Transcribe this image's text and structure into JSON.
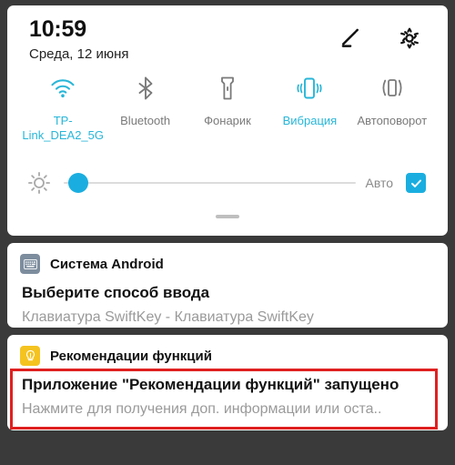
{
  "statusbar": {
    "time": "10:59",
    "date": "Среда, 12 июня",
    "edit_icon": "pencil-icon",
    "settings_icon": "gear-icon"
  },
  "quick_settings": {
    "tiles": [
      {
        "label": "TP-Link_DEA2_5G",
        "icon": "wifi-icon",
        "active": true
      },
      {
        "label": "Bluetooth",
        "icon": "bluetooth-icon",
        "active": false
      },
      {
        "label": "Фонарик",
        "icon": "flashlight-icon",
        "active": false
      },
      {
        "label": "Вибрация",
        "icon": "vibration-icon",
        "active": true
      },
      {
        "label": "Автоповорот",
        "icon": "auto-rotate-icon",
        "active": false
      }
    ],
    "brightness": {
      "icon": "brightness-sun-icon",
      "value_percent": 5,
      "auto_label": "Авто",
      "auto_checked": true
    },
    "drag_handle": "expand-handle"
  },
  "notifications": [
    {
      "app": "Система Android",
      "icon": "keyboard-icon",
      "title": "Выберите способ ввода",
      "body": "Клавиатура SwiftKey - Клавиатура SwiftKey",
      "highlighted": false
    },
    {
      "app": "Рекомендации функций",
      "icon": "lightbulb-icon",
      "title": "Приложение \"Рекомендации функций\" запущено",
      "body": "Нажмите для получения доп. информации или оста..",
      "highlighted": true
    }
  ],
  "colors": {
    "accent": "#28b6d8",
    "slider": "#1aaee0",
    "highlight_box": "#e02020",
    "shade_background": "#3a3a3a",
    "card": "#ffffff",
    "badge_keyboard": "#7d8d9e",
    "badge_bulb": "#f5c320"
  }
}
